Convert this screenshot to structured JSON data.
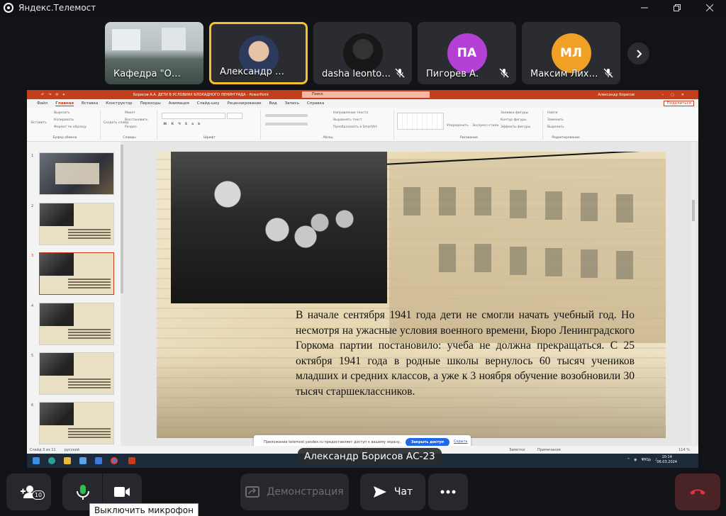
{
  "window": {
    "title": "Яндекс.Телемост"
  },
  "participants": [
    {
      "name": "Кафедра \"Обще…",
      "avatar_initials": "",
      "muted": false,
      "active": false
    },
    {
      "name": "Александр Бор…",
      "avatar_initials": "",
      "muted": false,
      "active": true
    },
    {
      "name": "dasha leonto…",
      "avatar_initials": "",
      "muted": true,
      "active": false
    },
    {
      "name": "Пигорев А.",
      "avatar_initials": "ПА",
      "avatar_color": "#b540d6",
      "muted": true,
      "active": false
    },
    {
      "name": "Максим Лих…",
      "avatar_initials": "МЛ",
      "avatar_color": "#f0a024",
      "muted": true,
      "active": false
    }
  ],
  "shared_screen": {
    "doc_title": "Борисов А.А. ДЕТИ В УСЛОВИЯХ БЛОКАДНОГО ЛЕНИНГРАДА - PowerPoint",
    "search_placeholder": "Поиск",
    "user_name": "Александр Борисов",
    "user_initials": "АБ",
    "share_label": "Поделиться",
    "ribbon_tabs": [
      "Файл",
      "Главная",
      "Вставка",
      "Конструктор",
      "Переходы",
      "Анимация",
      "Слайд-шоу",
      "Рецензирование",
      "Вид",
      "Запись",
      "Справка"
    ],
    "selected_tab": "Главная",
    "ribbon_groups": [
      "Буфер обмена",
      "Слайды",
      "Шрифт",
      "Абзац",
      "Рисование",
      "Редактирование"
    ],
    "ribbon_items": {
      "paste": "Вставить",
      "cut": "Вырезать",
      "copy": "Копировать",
      "format_painter": "Формат по образцу",
      "new_slide": "Создать слайд",
      "layout": "Макет",
      "reset": "Восстановить",
      "section": "Раздел",
      "text_direction": "Направление текста",
      "align_text": "Выровнять текст",
      "smartart": "Преобразовать в SmartArt",
      "arrange": "Упорядочить",
      "quick_styles": "Экспресс-стили",
      "shape_fill": "Заливка фигуры",
      "shape_outline": "Контур фигуры",
      "shape_effects": "Эффекты фигуры",
      "find": "Найти",
      "replace": "Заменить",
      "select": "Выделить"
    },
    "slide_numbers": [
      "1",
      "2",
      "3",
      "4",
      "5",
      "6"
    ],
    "selected_slide": "3",
    "thumb1_title": "ДЕТИ В УСЛОВИЯХ БЛОКАДНОГО ЛЕНИНГРАДА",
    "slide_text": "В начале сентября 1941 года дети не смогли начать учебный год. Но несмотря на ужасные условия военного времени, Бюро Ленинградского Горкома партии постановило: учеба не должна прекращаться. С 25 октября 1941 года в родные школы вернулось 60 тысяч учеников младших и средних классов, а уже к 3 ноября обучение возобновили 30 тысяч старшеклассников.",
    "notice": {
      "text": "Приложение telemost.yandex.ru предоставляет доступ к вашему экрану.",
      "allow_label": "Закрыть доступ",
      "hide_label": "Скрыть"
    },
    "statusbar": {
      "slide_info": "Слайд 3 из 11",
      "language": "русский",
      "notes": "Заметки",
      "comments": "Примечания",
      "zoom": "114 %"
    },
    "taskbar": {
      "lang": "РУС",
      "time": "10:14",
      "date": "06.03.2024"
    }
  },
  "presenter_label": "Александр Борисов АС-23",
  "bottom_bar": {
    "participants_count": "10",
    "demo_label": "Демонстрация",
    "chat_label": "Чат",
    "mic_tooltip": "Выключить микрофон"
  },
  "colors": {
    "accent_active": "#f2c12e",
    "end_call": "#e0323c",
    "powerpoint": "#c43e1c",
    "mic_on": "#2fbf4a"
  }
}
